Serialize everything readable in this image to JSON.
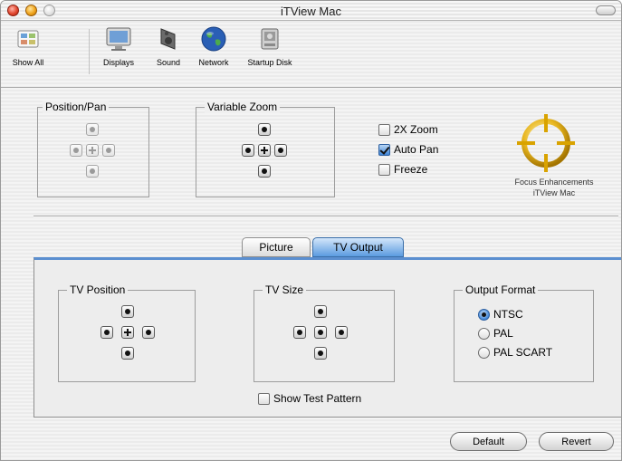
{
  "window": {
    "title": "iTView Mac"
  },
  "toolbar": {
    "items": [
      {
        "label": "Show All",
        "icon": "apple-show-all-icon"
      },
      {
        "label": "Displays",
        "icon": "display-icon"
      },
      {
        "label": "Sound",
        "icon": "speaker-icon"
      },
      {
        "label": "Network",
        "icon": "globe-icon"
      },
      {
        "label": "Startup Disk",
        "icon": "hard-disk-icon"
      }
    ]
  },
  "picture": {
    "position_pan": {
      "label": "Position/Pan",
      "enabled": false
    },
    "variable_zoom": {
      "label": "Variable Zoom"
    },
    "options": [
      {
        "label": "2X Zoom",
        "checked": false
      },
      {
        "label": "Auto Pan",
        "checked": true
      },
      {
        "label": "Freeze",
        "checked": false
      }
    ],
    "logo": {
      "line1": "Focus Enhancements",
      "line2": "iTView Mac",
      "color": "#d9a300"
    }
  },
  "tabs": [
    {
      "label": "Picture",
      "selected": false
    },
    {
      "label": "TV Output",
      "selected": true
    }
  ],
  "tv_output": {
    "tv_position": {
      "label": "TV Position"
    },
    "tv_size": {
      "label": "TV Size"
    },
    "output_format": {
      "label": "Output Format",
      "options": [
        {
          "label": "NTSC",
          "selected": true
        },
        {
          "label": "PAL",
          "selected": false
        },
        {
          "label": "PAL SCART",
          "selected": false
        }
      ]
    },
    "show_test_pattern": {
      "label": "Show Test Pattern",
      "checked": false
    }
  },
  "buttons": {
    "default": "Default",
    "revert": "Revert"
  },
  "colors": {
    "accent": "#3e84d6",
    "tab_selected": "#5b9be0"
  }
}
